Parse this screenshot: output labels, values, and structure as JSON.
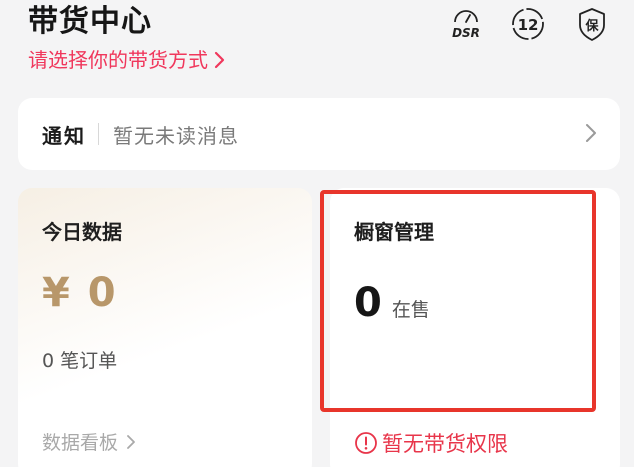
{
  "header": {
    "title": "带货中心",
    "mode_link": "请选择你的带货方式",
    "icons": [
      {
        "name": "dsr-gauge-icon",
        "label": "DSR"
      },
      {
        "name": "age-12-icon",
        "label": "12"
      },
      {
        "name": "guarantee-shield-icon",
        "label": "保"
      }
    ]
  },
  "notice": {
    "title": "通知",
    "message": "暂无未读消息"
  },
  "today": {
    "title": "今日数据",
    "gmv": "¥ 0",
    "orders": "0 笔订单",
    "board_link": "数据看板"
  },
  "window": {
    "title": "橱窗管理",
    "count": "0",
    "count_unit": "在售",
    "warning": "暂无带货权限"
  },
  "colors": {
    "accent": "#f0375c",
    "gold": "#b8976a",
    "highlight": "#e8352b"
  }
}
